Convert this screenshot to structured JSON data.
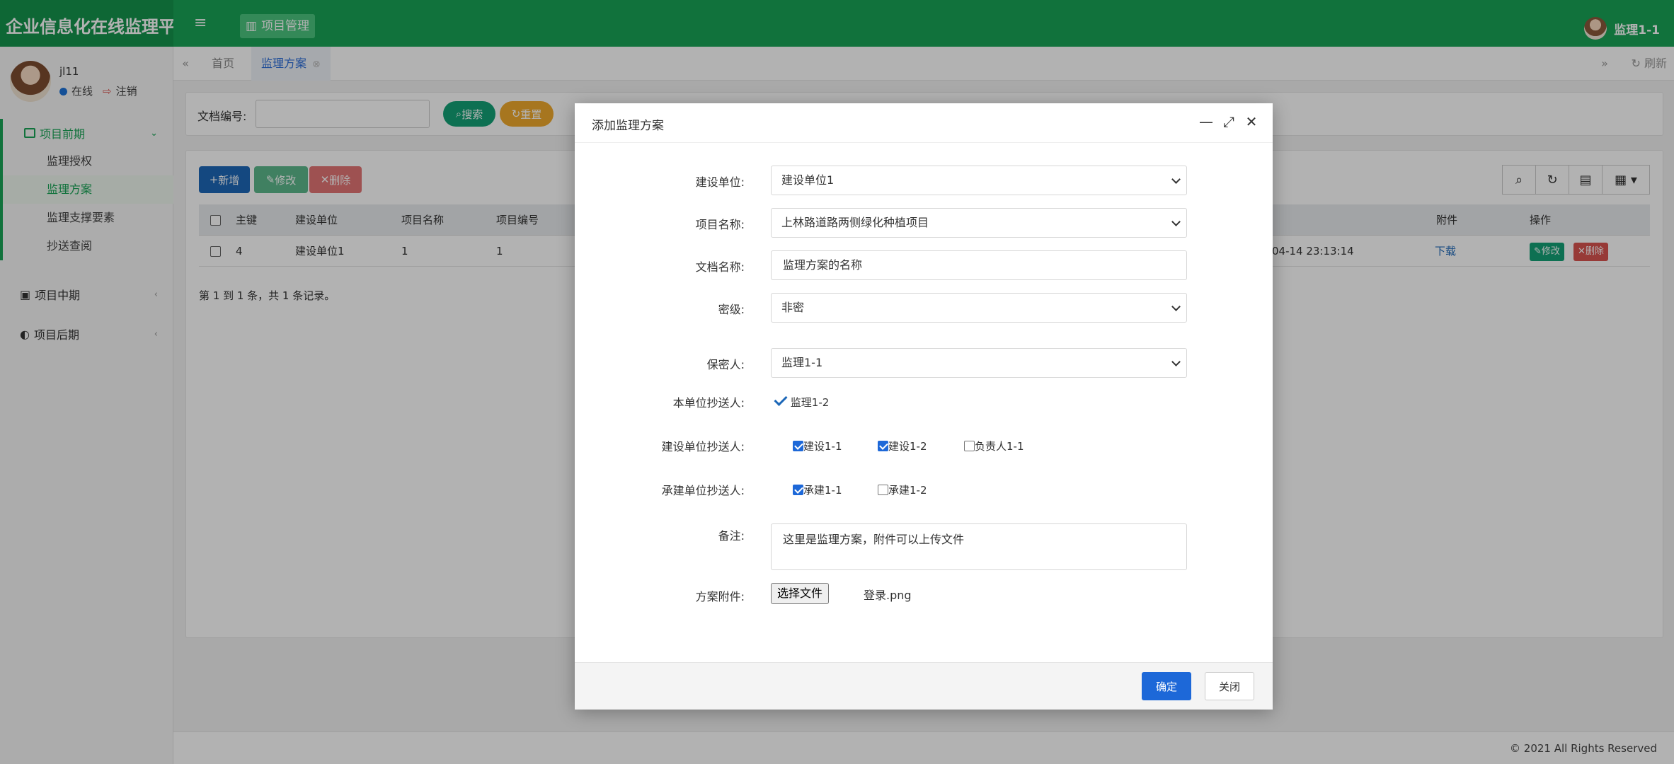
{
  "app": {
    "title": "企业信息化在线监理平台",
    "menu_label": "项目管理",
    "user_name": "监理1-1"
  },
  "profile": {
    "name": "jl11",
    "status": "在线",
    "logout": "注销"
  },
  "sidebar": {
    "groups": [
      {
        "label": "项目前期",
        "items": [
          "监理授权",
          "监理方案",
          "监理支撑要素",
          "抄送查阅"
        ]
      },
      {
        "label": "项目中期"
      },
      {
        "label": "项目后期"
      }
    ]
  },
  "tabs": {
    "home": "首页",
    "current": "监理方案",
    "refresh": "刷新"
  },
  "search": {
    "label": "文档编号:",
    "search_btn": "搜索",
    "reset_btn": "重置"
  },
  "toolbar": {
    "add": "新增",
    "edit": "修改",
    "delete": "删除"
  },
  "table": {
    "headers": [
      "主键",
      "建设单位",
      "项目名称",
      "项目编号",
      "附件",
      "操作"
    ],
    "rows": [
      {
        "id": "4",
        "unit": "建设单位1",
        "project_name": "1",
        "project_no": "1",
        "time": "04-14 23:13:14",
        "attachment": "下载",
        "edit": "修改",
        "delete": "删除"
      }
    ],
    "pager": "第 1 到 1 条，共 1 条记录。"
  },
  "footer": "© 2021 All Rights Reserved",
  "modal": {
    "title": "添加监理方案",
    "fields": {
      "unit": {
        "label": "建设单位:",
        "value": "建设单位1"
      },
      "project": {
        "label": "项目名称:",
        "value": "上林路道路两侧绿化种植项目"
      },
      "doc_name": {
        "label": "文档名称:",
        "value": "监理方案的名称"
      },
      "secret": {
        "label": "密级:",
        "value": "非密"
      },
      "keeper": {
        "label": "保密人:",
        "value": "监理1-1"
      },
      "cc_self": {
        "label": "本单位抄送人:",
        "options": [
          {
            "label": "监理1-2",
            "checked": true
          }
        ]
      },
      "cc_build": {
        "label": "建设单位抄送人:",
        "options": [
          {
            "label": "建设1-1",
            "checked": true
          },
          {
            "label": "建设1-2",
            "checked": true
          },
          {
            "label": "负责人1-1",
            "checked": false
          }
        ]
      },
      "cc_contractor": {
        "label": "承建单位抄送人:",
        "options": [
          {
            "label": "承建1-1",
            "checked": true
          },
          {
            "label": "承建1-2",
            "checked": false
          }
        ]
      },
      "remark": {
        "label": "备注:",
        "value": "这里是监理方案，附件可以上传文件"
      },
      "attachment": {
        "label": "方案附件:",
        "button": "选择文件",
        "file": "登录.png"
      }
    },
    "ok": "确定",
    "close": "关闭"
  },
  "colors": {
    "brand": "#19a456",
    "primary": "#1d68d8",
    "danger": "#d9534f",
    "warning": "#f0a92d"
  }
}
